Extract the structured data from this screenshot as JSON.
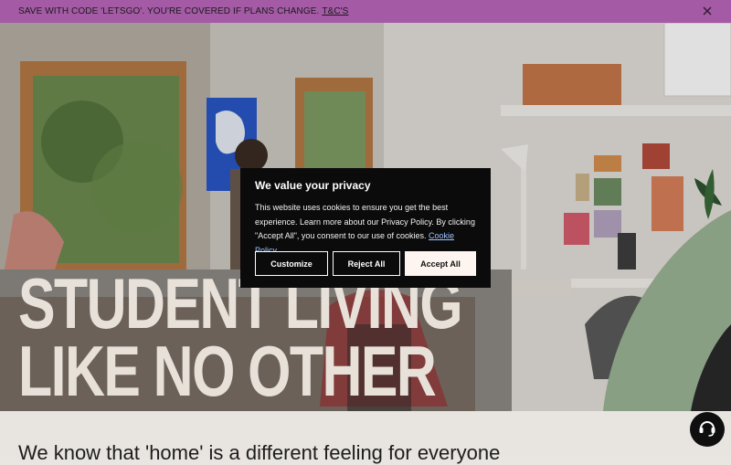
{
  "promo": {
    "text": "SAVE WITH CODE 'LETSGO'. YOU'RE COVERED IF PLANS CHANGE.",
    "link": "T&C'S",
    "close_icon": "close-icon"
  },
  "hero": {
    "line1": "STUDENT LIVING",
    "line2": "LIKE NO OTHER"
  },
  "intro": {
    "text": "We know that 'home' is a different feeling for everyone"
  },
  "cookie": {
    "title": "We value your privacy",
    "body": "This website uses cookies to ensure you get the best experience. Learn more about our Privacy Policy. By clicking \"Accept All\", you consent to our use of cookies.",
    "link": "Cookie Policy",
    "customize": "Customize",
    "reject": "Reject All",
    "accept": "Accept All"
  },
  "chat": {
    "icon": "chat-headset-icon"
  },
  "colors": {
    "promo_bg": "#a45aa5",
    "modal_bg": "#0b0b0b",
    "accent_green": "#9bb596",
    "link_blue": "#9ec6ff"
  }
}
